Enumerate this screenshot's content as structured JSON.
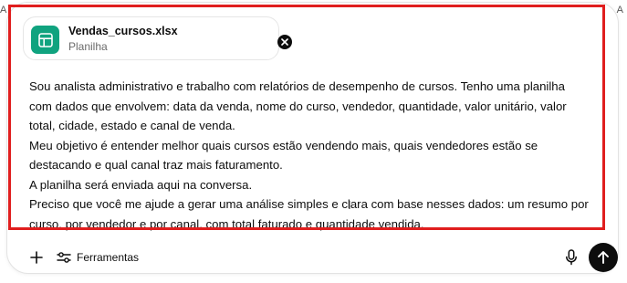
{
  "edge": {
    "left_text": "A",
    "right_text": "A"
  },
  "attachment": {
    "file_name": "Vendas_cursos.xlsx",
    "file_type": "Planilha",
    "icon": "spreadsheet-icon",
    "icon_color": "#10a37f"
  },
  "message": {
    "lines": [
      "Sou analista administrativo e trabalho com relatórios de desempenho de cursos. Tenho uma planilha",
      "com dados que envolvem: data da venda, nome do curso, vendedor, quantidade, valor unitário, valor",
      "total, cidade, estado e canal de venda.",
      "Meu objetivo é entender melhor quais cursos estão vendendo mais, quais vendedores estão se",
      "destacando e qual canal traz mais faturamento.",
      "A planilha será enviada aqui na conversa.",
      "Preciso que você me ajude a gerar uma análise simples e clara com base nesses dados: um resumo por",
      "curso, por vendedor e por canal, com total faturado e quantidade vendida."
    ]
  },
  "toolbar": {
    "add_icon": "plus-icon",
    "tools_label": "Ferramentas",
    "tools_icon": "sliders-icon",
    "mic_icon": "microphone-icon",
    "send_icon": "arrow-up-icon"
  },
  "colors": {
    "highlight_border": "#e01e1e",
    "send_button": "#0d0d0d"
  }
}
